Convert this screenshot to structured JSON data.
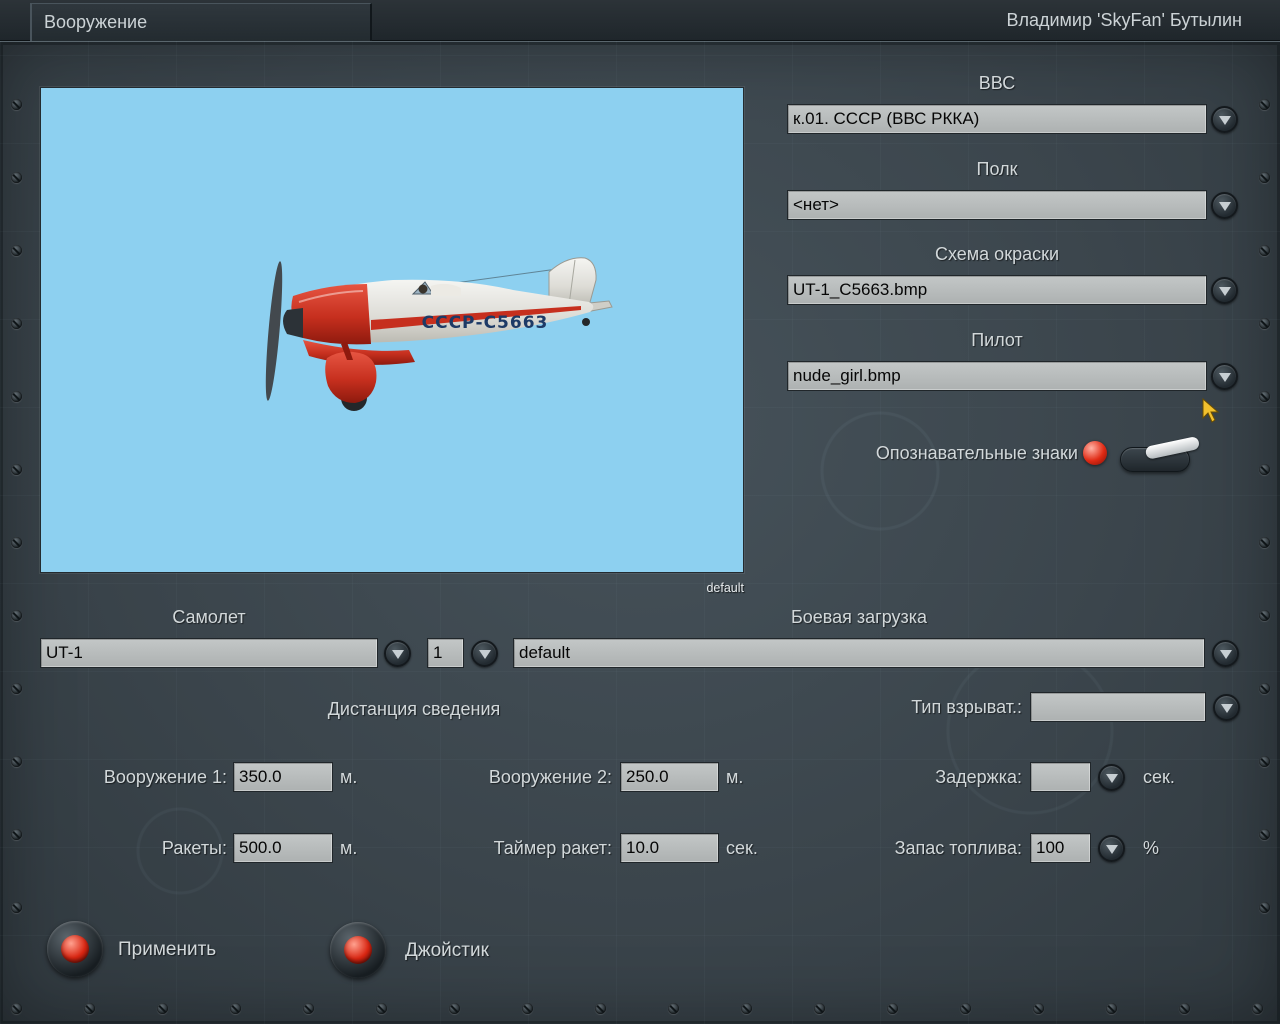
{
  "header": {
    "tab_title": "Вооружение",
    "player_name": "Владимир 'SkyFan' Бутылин"
  },
  "preview": {
    "marking": "СССР-С5663",
    "caption": "default"
  },
  "right_panel": {
    "vvs_label": "ВВС",
    "vvs_value": "к.01. СССР (ВВС РККА)",
    "regiment_label": "Полк",
    "regiment_value": "<нет>",
    "skin_label": "Схема окраски",
    "skin_value": "UT-1_C5663.bmp",
    "pilot_label": "Пилот",
    "pilot_value": "nude_girl.bmp",
    "markings_label": "Опознавательные знаки"
  },
  "aircraft": {
    "label": "Самолет",
    "value": "UT-1",
    "count": "1",
    "loadout_label": "Боевая загрузка",
    "loadout_value": "default"
  },
  "convergence": {
    "title": "Дистанция сведения",
    "fuse_label": "Тип взрыват.:",
    "fuse_value": "",
    "weapon1_label": "Вооружение 1:",
    "weapon1_value": "350.0",
    "weapon1_unit": "м.",
    "weapon2_label": "Вооружение 2:",
    "weapon2_value": "250.0",
    "weapon2_unit": "м.",
    "delay_label": "Задержка:",
    "delay_value": "",
    "delay_unit": "сек.",
    "rockets_label": "Ракеты:",
    "rockets_value": "500.0",
    "rockets_unit": "м.",
    "rocket_timer_label": "Таймер ракет:",
    "rocket_timer_value": "10.0",
    "rocket_timer_unit": "сек.",
    "fuel_label": "Запас топлива:",
    "fuel_value": "100",
    "fuel_unit": "%"
  },
  "buttons": {
    "apply": "Применить",
    "joystick": "Джойстик"
  },
  "colors": {
    "panel": "#3b454c",
    "topbar": "#262d32",
    "field": "#b7bbbb",
    "sky": "#8dd0f0",
    "signal_red": "#d92612",
    "cursor_yellow": "#f2c12e"
  }
}
